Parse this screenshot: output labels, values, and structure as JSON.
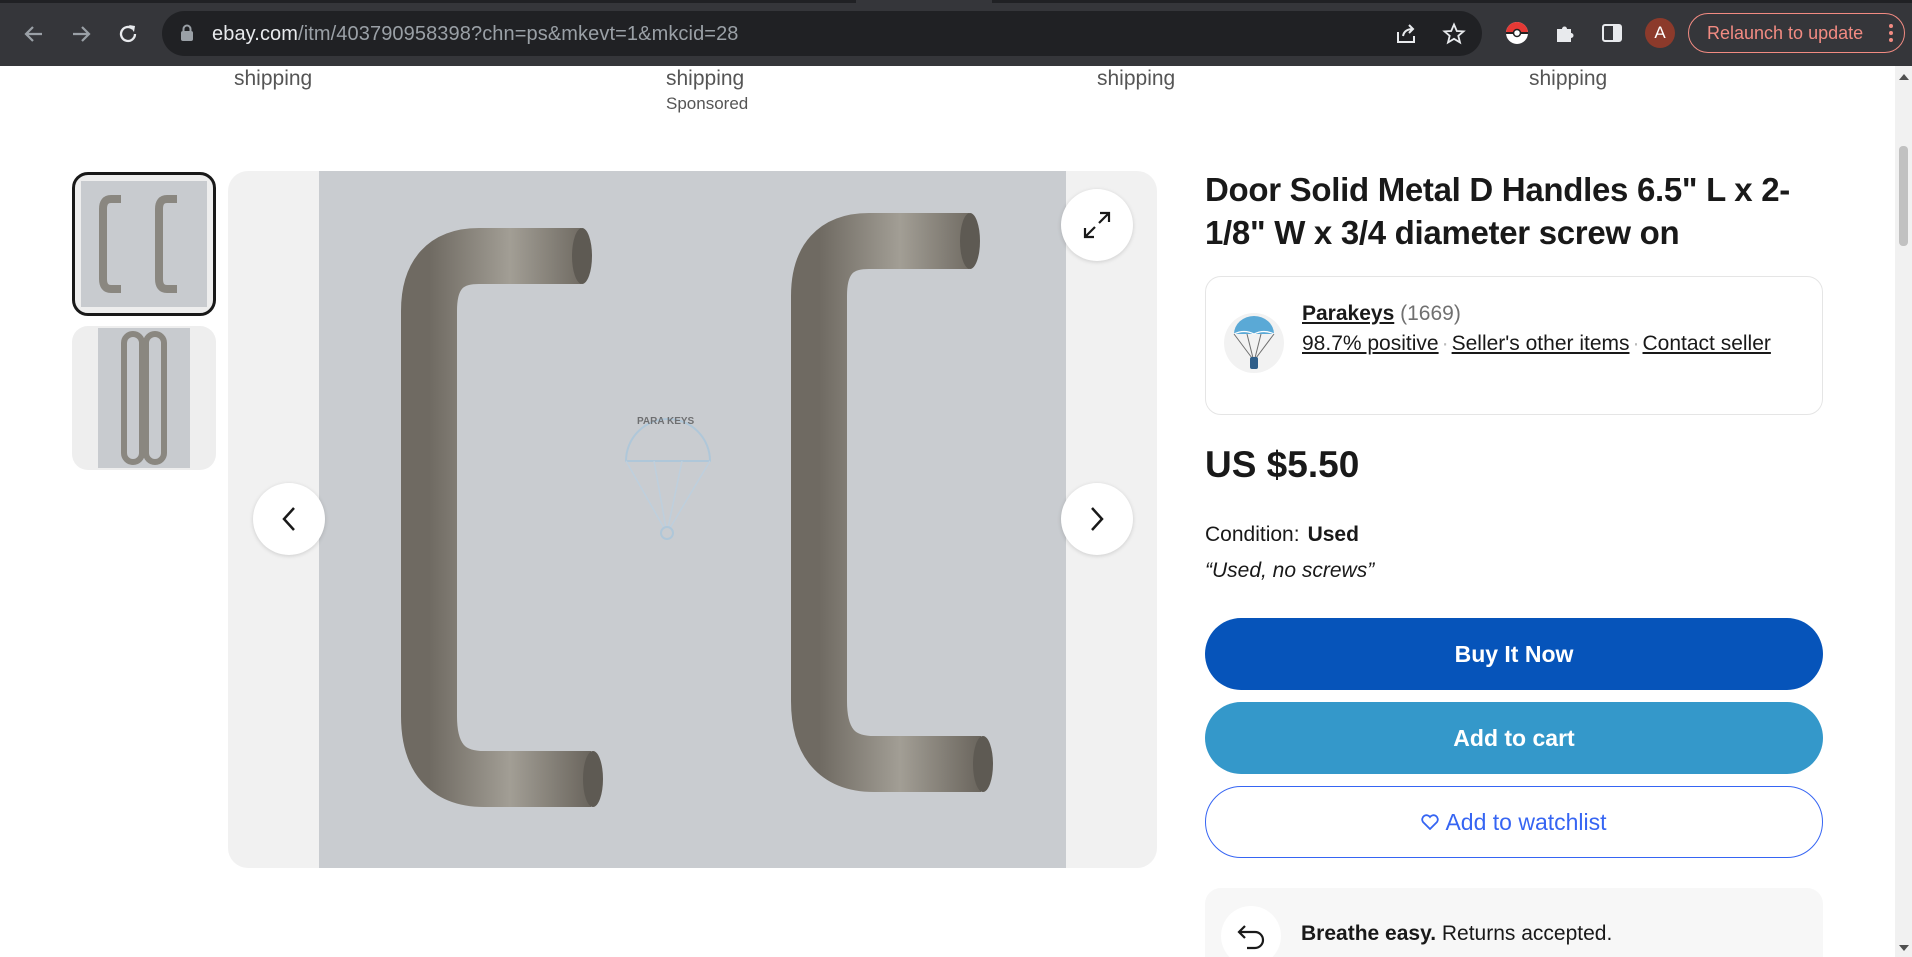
{
  "browser": {
    "url_host": "ebay.com",
    "url_path": "/itm/403790958398?chn=ps&mkevt=1&mkcid=28",
    "avatar_letter": "A",
    "relaunch_label": "Relaunch to update"
  },
  "carousel_above": {
    "shipping_labels": [
      "shipping",
      "shipping",
      "shipping",
      "shipping"
    ],
    "sponsored_label": "Sponsored"
  },
  "product": {
    "title": "Door Solid Metal D Handles 6.5\" L x 2-1/8\" W x 3/4 diameter screw on",
    "price": "US $5.50",
    "condition_label": "Condition:",
    "condition_value": "Used",
    "condition_note": "“Used, no screws”",
    "photo_watermark": "PARA KEYS"
  },
  "seller": {
    "name": "Parakeys",
    "feedback_count": "(1669)",
    "positive": "98.7% positive",
    "other_items": "Seller's other items",
    "contact": "Contact seller"
  },
  "actions": {
    "buy_now": "Buy It Now",
    "add_to_cart": "Add to cart",
    "add_to_watchlist": "Add to watchlist"
  },
  "returns": {
    "bold": "Breathe easy.",
    "rest": " Returns accepted."
  },
  "colors": {
    "buy_now": "#0654ba",
    "add_to_cart": "#3498ca",
    "watchlist": "#3665f3",
    "chrome_bg": "#35363a",
    "relaunch": "#f28b82"
  }
}
